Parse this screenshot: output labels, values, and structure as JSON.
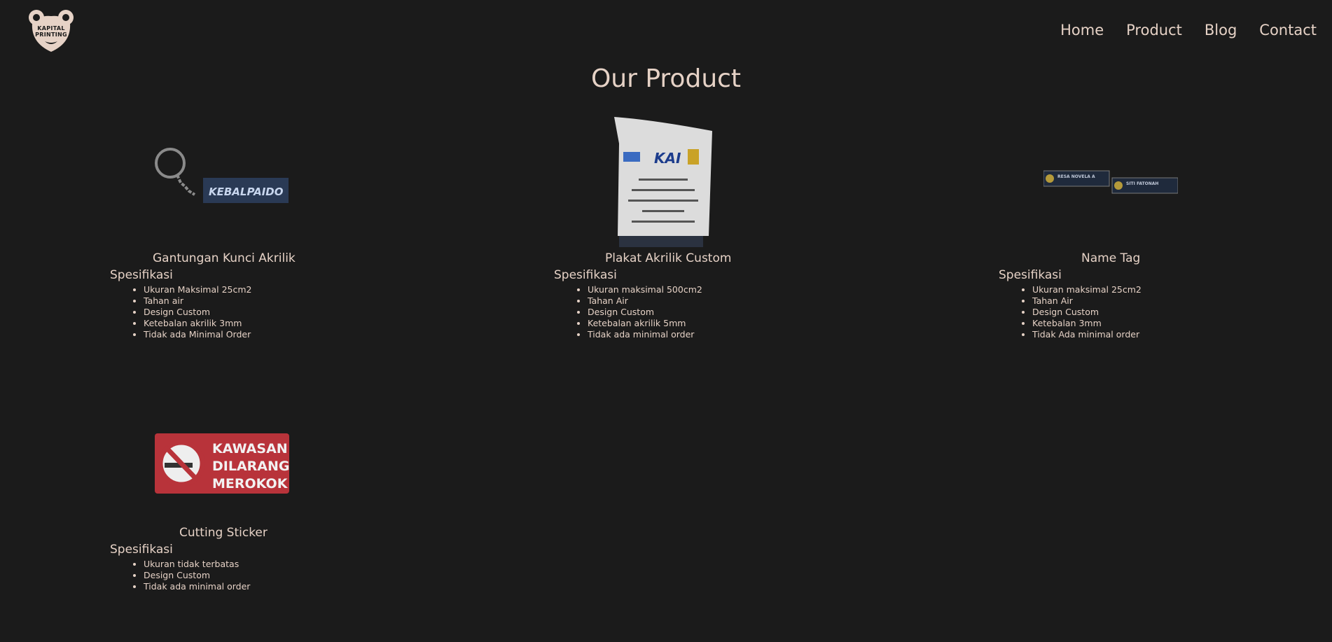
{
  "brand": {
    "logo_line1": "KAPITAL",
    "logo_line2": "PRINTING"
  },
  "nav": {
    "items": [
      "Home",
      "Product",
      "Blog",
      "Contact"
    ]
  },
  "page": {
    "title": "Our Product"
  },
  "products": [
    {
      "name": "Gantungan Kunci Akrilik",
      "spec_title": "Spesifikasi",
      "image_text": "KEBALPAIDO",
      "specs": [
        "Ukuran Maksimal 25cm2",
        "Tahan air",
        "Design Custom",
        "Ketebalan akrilik 3mm",
        "Tidak ada Minimal Order"
      ]
    },
    {
      "name": "Plakat Akrilik Custom",
      "spec_title": "Spesifikasi",
      "image_text": "KAI",
      "specs": [
        "Ukuran maksimal 500cm2",
        "Tahan Air",
        "Design Custom",
        "Ketebalan akrilik 5mm",
        "Tidak ada minimal order"
      ]
    },
    {
      "name": "Name Tag",
      "spec_title": "Spesifikasi",
      "image_text_1": "RESA NOVELA A",
      "image_text_2": "SITI FATONAH",
      "specs": [
        "Ukuran maksimal 25cm2",
        "Tahan Air",
        "Design Custom",
        "Ketebalan 3mm",
        "Tidak Ada minimal order"
      ]
    },
    {
      "name": "Cutting Sticker",
      "spec_title": "Spesifikasi",
      "image_text": [
        "KAWASAN",
        "DILARANG",
        "MEROKOK"
      ],
      "specs": [
        "Ukuran tidak terbatas",
        "Design Custom",
        "Tidak ada minimal order"
      ]
    }
  ],
  "colors": {
    "background": "#1b1b1b",
    "text": "#e6d2c6",
    "sticker_red": "#b8333a"
  }
}
